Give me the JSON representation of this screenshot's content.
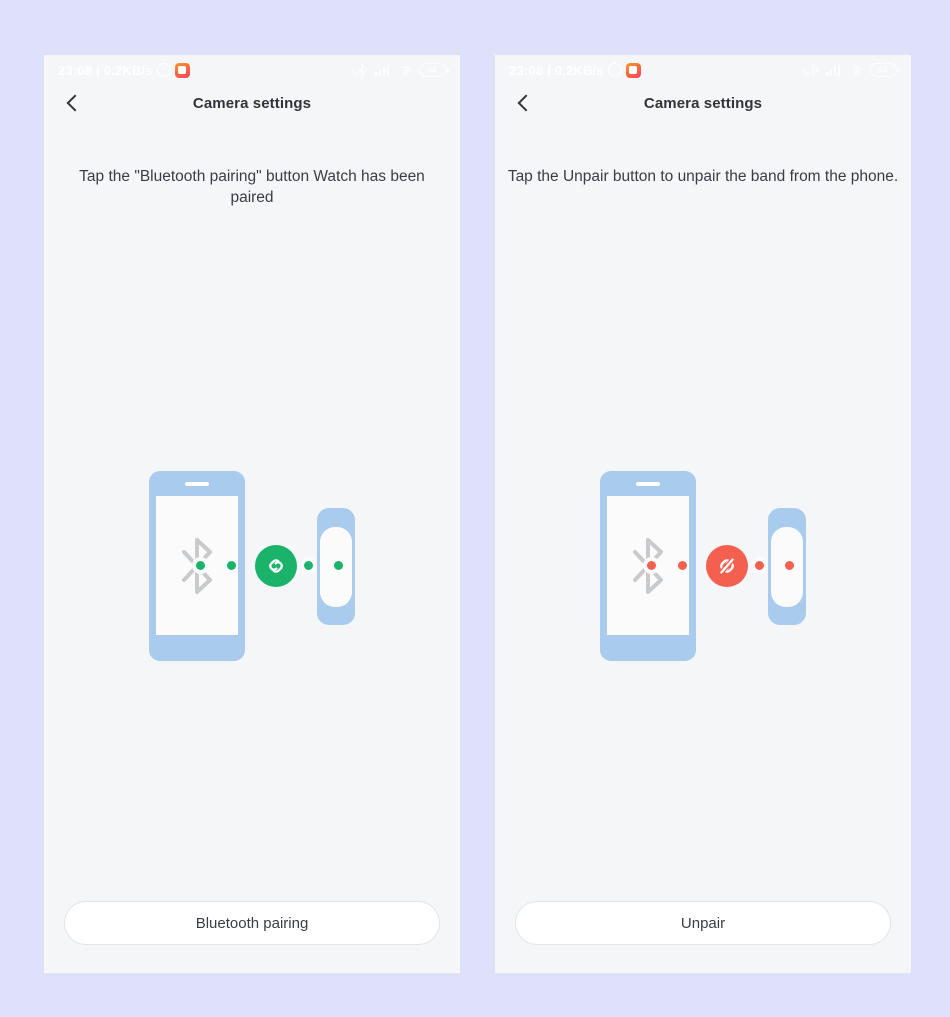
{
  "background_color": "#dfe1fb",
  "panel_color": "#f5f6f8",
  "panels": [
    {
      "id": "paired",
      "statusbar": {
        "clock": "23:08 | 0.2KB/s",
        "alarm_icon": "alarm-clock-icon",
        "app_icon": "mi-fit-app-icon",
        "bluetooth_icon": "bluetooth-icon",
        "signal_icon": "cellular-signal-icon",
        "wifi_icon": "wifi-icon",
        "battery_level": "62"
      },
      "titlebar": {
        "back_icon": "back-chevron-icon",
        "title": "Camera settings"
      },
      "instruction": "Tap the \"Bluetooth pairing\" button Watch has been paired",
      "illustration": {
        "phone_icon": "phone-graphic",
        "band_icon": "fitness-band-graphic",
        "bluetooth_glyph": "bluetooth-glyph-icon",
        "badge_icon": "link-connected-icon",
        "badge_color": "#1bb36a",
        "dot_color": "#1bb36a",
        "phone_body_color": "#a9cbee"
      },
      "action_button": "Bluetooth pairing"
    },
    {
      "id": "unpair",
      "statusbar": {
        "clock": "23:08 | 0.2KB/s",
        "alarm_icon": "alarm-clock-icon",
        "app_icon": "mi-fit-app-icon",
        "bluetooth_icon": "bluetooth-icon",
        "signal_icon": "cellular-signal-icon",
        "wifi_icon": "wifi-icon",
        "battery_level": "62"
      },
      "titlebar": {
        "back_icon": "back-chevron-icon",
        "title": "Camera settings"
      },
      "instruction": "Tap the Unpair button to unpair the band from the phone.",
      "illustration": {
        "phone_icon": "phone-graphic",
        "band_icon": "fitness-band-graphic",
        "bluetooth_glyph": "bluetooth-glyph-icon",
        "badge_icon": "link-broken-icon",
        "badge_color": "#f4604f",
        "dot_color": "#f4604f",
        "phone_body_color": "#a9cbee"
      },
      "action_button": "Unpair"
    }
  ]
}
